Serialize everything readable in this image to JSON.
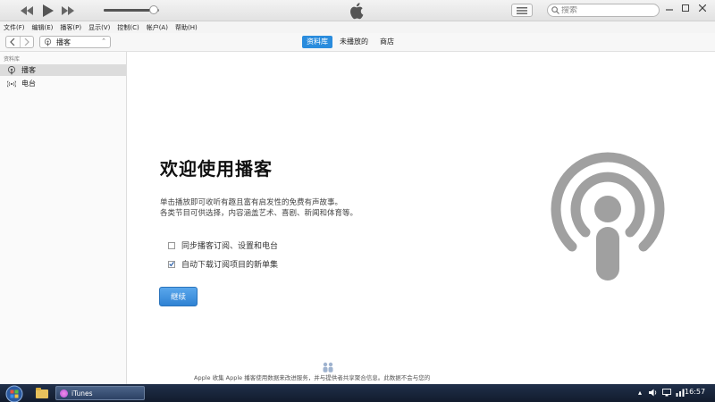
{
  "player": {
    "volume_fraction": 0.9
  },
  "search": {
    "placeholder": "搜索"
  },
  "menubar": {
    "items": [
      "文件(F)",
      "编辑(E)",
      "播客(P)",
      "显示(V)",
      "控制(C)",
      "帐户(A)",
      "帮助(H)"
    ]
  },
  "navbar": {
    "media_kind": "播客",
    "tabs": [
      {
        "label": "资料库",
        "active": true
      },
      {
        "label": "未播放的",
        "active": false
      },
      {
        "label": "商店",
        "active": false
      }
    ]
  },
  "sidebar": {
    "heading": "资料库",
    "items": [
      {
        "label": "播客",
        "selected": true,
        "icon": "podcast-icon"
      },
      {
        "label": "电台",
        "selected": false,
        "icon": "radio-icon"
      }
    ]
  },
  "main": {
    "title": "欢迎使用播客",
    "desc_line1": "单击播放即可收听有趣且富有启发性的免费有声故事。",
    "desc_line2": "各类节目可供选择，内容涵盖艺术、喜剧、新闻和体育等。",
    "options": [
      {
        "label": "同步播客订阅、设置和电台",
        "checked": false
      },
      {
        "label": "自动下载订阅项目的新单集",
        "checked": true
      }
    ],
    "continue_label": "继续",
    "footer_note": "Apple 收集 Apple 播客使用数据来改进服务，并与提供者共享聚合信息。",
    "footer_note_tail": "此数据不会与您的"
  },
  "taskbar": {
    "app_label": "iTunes",
    "clock": "16:57"
  },
  "colors": {
    "accent": "#2a8cdd",
    "logo_gray": "#9a9a9a"
  }
}
